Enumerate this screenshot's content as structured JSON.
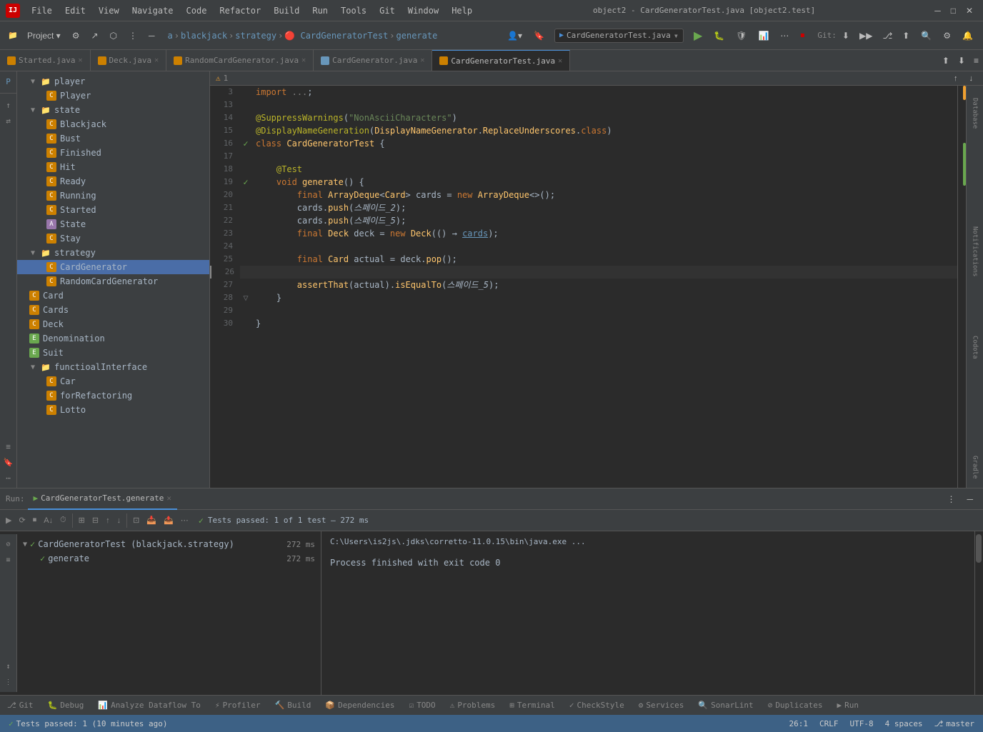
{
  "app": {
    "title": "object2 - CardGeneratorTest.java [object2.test]",
    "icon": "IJ"
  },
  "menu": {
    "items": [
      "File",
      "Edit",
      "View",
      "Navigate",
      "Code",
      "Refactor",
      "Build",
      "Run",
      "Tools",
      "Git",
      "Window",
      "Help"
    ]
  },
  "breadcrumb": {
    "items": [
      "a",
      "blackjack",
      "strategy",
      "CardGeneratorTest",
      "generate"
    ]
  },
  "tabs": [
    {
      "label": "Started.java",
      "type": "java",
      "active": false,
      "modified": false
    },
    {
      "label": "Deck.java",
      "type": "java",
      "active": false,
      "modified": false
    },
    {
      "label": "RandomCardGenerator.java",
      "type": "java",
      "active": false,
      "modified": false
    },
    {
      "label": "CardGenerator.java",
      "type": "interface",
      "active": false,
      "modified": false
    },
    {
      "label": "CardGeneratorTest.java",
      "type": "test",
      "active": true,
      "modified": false
    }
  ],
  "tree": {
    "items": [
      {
        "indent": 1,
        "type": "folder",
        "label": "player",
        "expanded": true
      },
      {
        "indent": 2,
        "type": "class",
        "label": "Player",
        "color": "orange"
      },
      {
        "indent": 1,
        "type": "folder",
        "label": "state",
        "expanded": true
      },
      {
        "indent": 2,
        "type": "class",
        "label": "Blackjack",
        "color": "orange"
      },
      {
        "indent": 2,
        "type": "class",
        "label": "Bust",
        "color": "orange"
      },
      {
        "indent": 2,
        "type": "class",
        "label": "Finished",
        "color": "orange"
      },
      {
        "indent": 2,
        "type": "class",
        "label": "Hit",
        "color": "orange"
      },
      {
        "indent": 2,
        "type": "class",
        "label": "Ready",
        "color": "orange"
      },
      {
        "indent": 2,
        "type": "class",
        "label": "Running",
        "color": "orange"
      },
      {
        "indent": 2,
        "type": "class",
        "label": "Started",
        "color": "orange"
      },
      {
        "indent": 2,
        "type": "class",
        "label": "State",
        "color": "abstract"
      },
      {
        "indent": 2,
        "type": "class",
        "label": "Stay",
        "color": "orange"
      },
      {
        "indent": 1,
        "type": "folder",
        "label": "strategy",
        "expanded": true,
        "selected": false
      },
      {
        "indent": 2,
        "type": "class",
        "label": "CardGenerator",
        "color": "orange",
        "selected": true
      },
      {
        "indent": 2,
        "type": "class",
        "label": "RandomCardGenerator",
        "color": "orange"
      },
      {
        "indent": 1,
        "type": "class",
        "label": "Card",
        "color": "orange"
      },
      {
        "indent": 1,
        "type": "class",
        "label": "Cards",
        "color": "orange"
      },
      {
        "indent": 1,
        "type": "class",
        "label": "Deck",
        "color": "orange"
      },
      {
        "indent": 1,
        "type": "enum",
        "label": "Denomination",
        "color": "green"
      },
      {
        "indent": 1,
        "type": "enum",
        "label": "Suit",
        "color": "green"
      },
      {
        "indent": 1,
        "type": "folder",
        "label": "functioalInterface",
        "expanded": true
      },
      {
        "indent": 2,
        "type": "class",
        "label": "Car",
        "color": "orange"
      },
      {
        "indent": 2,
        "type": "class",
        "label": "forRefactoring",
        "color": "orange"
      },
      {
        "indent": 2,
        "type": "class",
        "label": "Lotto",
        "color": "orange"
      }
    ]
  },
  "code": {
    "lines": [
      {
        "num": 3,
        "content": "import ...;"
      },
      {
        "num": 13,
        "content": ""
      },
      {
        "num": 14,
        "content": "@SuppressWarnings(\"NonAsciiCharacters\")",
        "type": "annotation"
      },
      {
        "num": 15,
        "content": "@DisplayNameGeneration(DisplayNameGenerator.ReplaceUnderscores.class)",
        "type": "annotation"
      },
      {
        "num": 16,
        "content": "class CardGeneratorTest {",
        "type": "class_decl",
        "has_check": true
      },
      {
        "num": 17,
        "content": ""
      },
      {
        "num": 18,
        "content": "    @Test"
      },
      {
        "num": 19,
        "content": "    void generate() {",
        "has_check": true,
        "has_arrow": true
      },
      {
        "num": 20,
        "content": "        final ArrayDeque<Card> cards = new ArrayDeque<>();"
      },
      {
        "num": 21,
        "content": "        cards.push(스페이드_2);"
      },
      {
        "num": 22,
        "content": "        cards.push(스페이드_5);"
      },
      {
        "num": 23,
        "content": "        final Deck deck = new Deck(() → cards);"
      },
      {
        "num": 24,
        "content": ""
      },
      {
        "num": 25,
        "content": "        final Card actual = deck.pop();"
      },
      {
        "num": 26,
        "content": ""
      },
      {
        "num": 27,
        "content": "        assertThat(actual).isEqualTo(스페이드_5);"
      },
      {
        "num": 28,
        "content": "    }",
        "has_fold": true
      },
      {
        "num": 29,
        "content": ""
      },
      {
        "num": 30,
        "content": "}"
      }
    ]
  },
  "run_panel": {
    "tab_label": "CardGeneratorTest.generate",
    "status": "Tests passed: 1 of 1 test – 272 ms",
    "command": "C:\\Users\\is2js\\.jdks\\corretto-11.0.15\\bin\\java.exe ...",
    "output": "Process finished with exit code 0",
    "test_name": "CardGeneratorTest (blackjack.strategy)",
    "test_time": "272 ms",
    "test_method": "generate",
    "test_method_time": "272 ms"
  },
  "status_bar": {
    "left": "Tests passed: 1 (10 minutes ago)",
    "position": "26:1",
    "encoding": "CRLF",
    "charset": "UTF-8",
    "indent": "4 spaces",
    "branch": "master",
    "warnings": "1"
  },
  "bottom_tabs": [
    {
      "label": "Git",
      "active": false
    },
    {
      "label": "Debug",
      "active": false
    },
    {
      "label": "Analyze Dataflow To",
      "active": false
    },
    {
      "label": "Profiler",
      "active": false
    },
    {
      "label": "Build",
      "active": false
    },
    {
      "label": "Dependencies",
      "active": false
    },
    {
      "label": "TODO",
      "active": false
    },
    {
      "label": "Problems",
      "active": false
    },
    {
      "label": "Terminal",
      "active": false
    },
    {
      "label": "CheckStyle",
      "active": false
    },
    {
      "label": "Services",
      "active": false
    },
    {
      "label": "SonarLint",
      "active": false
    },
    {
      "label": "Duplicates",
      "active": false
    }
  ],
  "right_sidebar": {
    "items": [
      "Database",
      "Notifications",
      "Codota",
      "Gradle"
    ]
  },
  "left_vtabs": {
    "items": [
      "Project",
      "Commit",
      "Pull Requests",
      "Structure"
    ]
  }
}
